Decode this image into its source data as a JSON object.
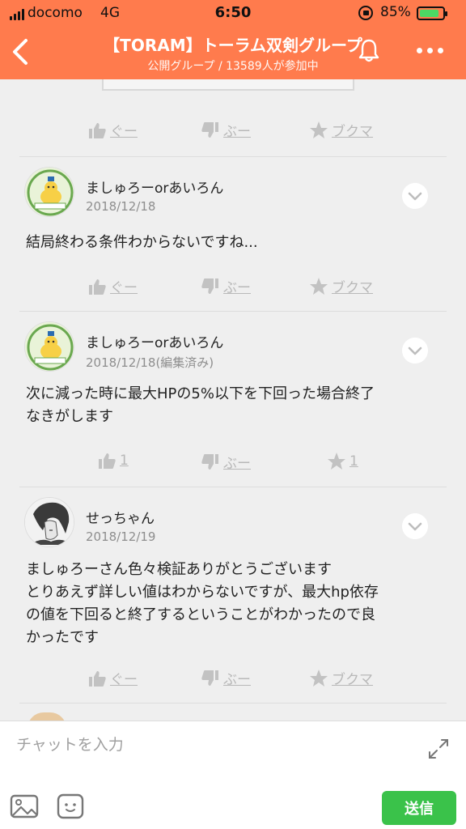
{
  "status_bar": {
    "carrier": "docomo",
    "network": "4G",
    "time": "6:50",
    "battery_percent_label": "85%",
    "battery_level": 0.85
  },
  "header": {
    "title": "【TORAM】トーラム双剣グループ",
    "subtitle": "公開グループ / 13589人が参加中",
    "accent_color": "#ff7b4d"
  },
  "top_reactions": {
    "good": "ぐー",
    "boo": "ぶー",
    "bookmark": "ブクマ"
  },
  "posts": [
    {
      "name": "ましゅろーorあいろん",
      "date": "2018/12/18",
      "text": "結局終わる条件わからないですね...",
      "reactions": {
        "good": "ぐー",
        "boo": "ぶー",
        "bookmark": "ブクマ"
      }
    },
    {
      "name": "ましゅろーorあいろん",
      "date": "2018/12/18(編集済み)",
      "text": "次に減った時に最大HPの5%以下を下回った場合終了\nなきがします",
      "reactions": {
        "good": "1",
        "boo": "ぶー",
        "bookmark": "1"
      }
    },
    {
      "name": "せっちゃん",
      "date": "2018/12/19",
      "text": "ましゅろーさん色々検証ありがとうございます\nとりあえず詳しい値はわからないですが、最大hp依存\nの値を下回ると終了するということがわかったので良\nかったです",
      "reactions": {
        "good": "ぐー",
        "boo": "ぶー",
        "bookmark": "ブクマ"
      }
    }
  ],
  "composer": {
    "placeholder": "チャットを入力",
    "send_label": "送信",
    "send_color": "#3ac24a"
  }
}
